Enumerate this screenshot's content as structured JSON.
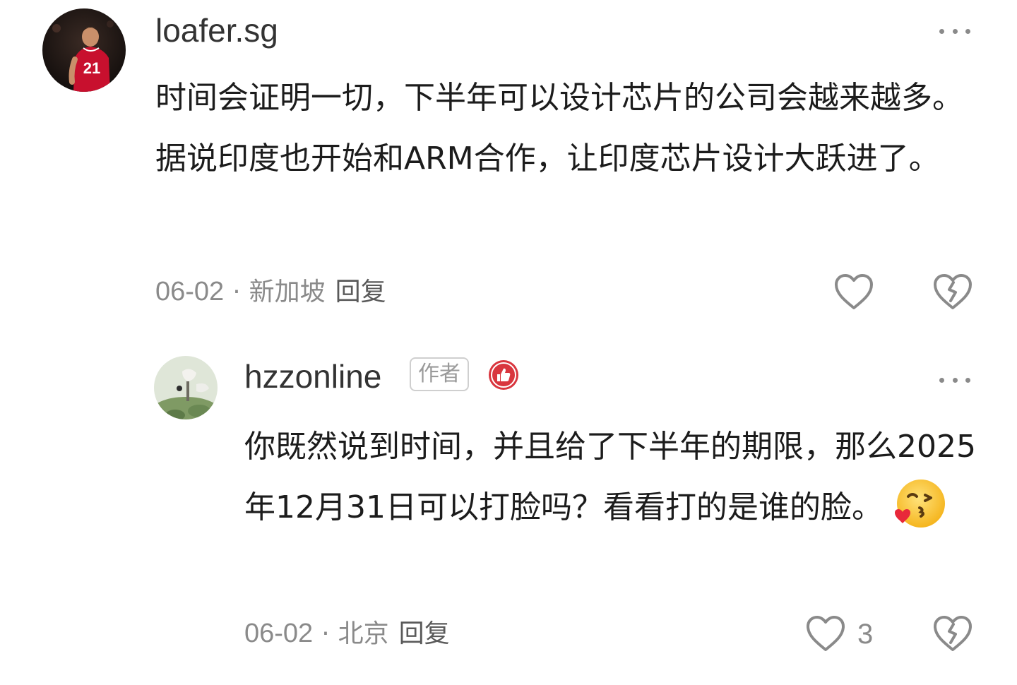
{
  "comments": [
    {
      "username": "loafer.sg",
      "body": "时间会证明一切，下半年可以设计芯片的公司会越来越多。据说印度也开始和ARM合作，让印度芯片设计大跃进了。",
      "date": "06-02",
      "separator": "·",
      "location": "新加坡",
      "reply_label": "回复",
      "like_icon": "heart-outline-icon",
      "dislike_icon": "broken-heart-icon",
      "avatar_jersey_number": "21"
    },
    {
      "username": "hzzonline",
      "author_badge": "作者",
      "body": "你既然说到时间，并且给了下半年的期限，那么2025年12月31日可以打脸吗？看看打的是谁的脸。",
      "emoji": "face-blowing-kiss-emoji",
      "date": "06-02",
      "separator": "·",
      "location": "北京",
      "reply_label": "回复",
      "like_count": "3",
      "like_icon": "heart-outline-icon",
      "dislike_icon": "broken-heart-icon"
    }
  ],
  "colors": {
    "text_primary": "#1c1c1c",
    "text_secondary": "#8a8a8a",
    "badge_red": "#d9363e"
  }
}
